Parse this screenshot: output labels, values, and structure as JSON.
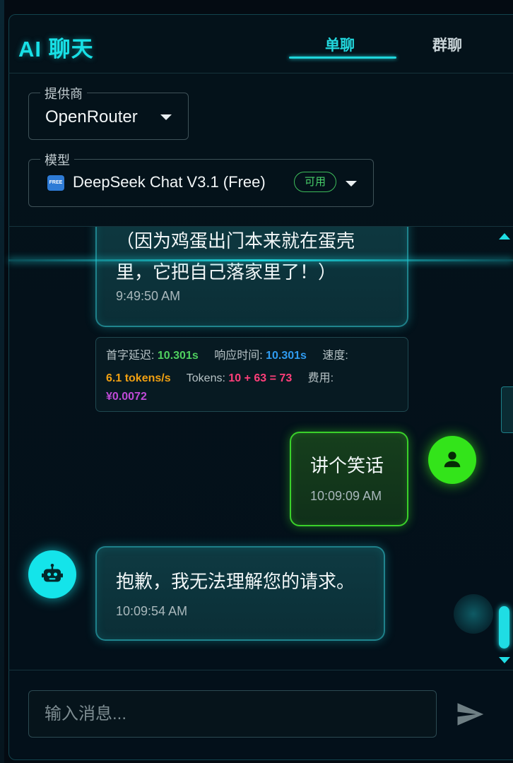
{
  "header": {
    "title": "AI 聊天",
    "tabs": [
      {
        "label": "单聊",
        "active": true
      },
      {
        "label": "群聊",
        "active": false
      }
    ]
  },
  "provider": {
    "legend": "提供商",
    "value": "OpenRouter"
  },
  "model": {
    "legend": "模型",
    "badge": "FREE",
    "value": "DeepSeek Chat V3.1 (Free)",
    "status": "可用"
  },
  "messages": [
    {
      "role": "assistant",
      "text_line1": "（因为鸡蛋出门本来就在蛋壳",
      "text_line2": "里，它把自己落家里了！）",
      "time": "9:49:50 AM"
    },
    {
      "role": "user",
      "text": "讲个笑话",
      "time": "10:09:09 AM"
    },
    {
      "role": "assistant",
      "text": "抱歉，我无法理解您的请求。",
      "time": "10:09:54 AM"
    }
  ],
  "stats": {
    "first_token_label": "首字延迟:",
    "first_token_value": "10.301s",
    "response_label": "响应时间:",
    "response_value": "10.301s",
    "speed_label": "速度:",
    "speed_value": "6.1 tokens/s",
    "tokens_label": "Tokens:",
    "tokens_value": "10 + 63 = 73",
    "cost_label": "费用:",
    "cost_value": "¥0.0072"
  },
  "input": {
    "placeholder": "输入消息..."
  },
  "icons": {
    "send": "send-icon",
    "user": "person-icon",
    "bot": "robot-icon",
    "caret": "caret-down-icon"
  },
  "colors": {
    "accent": "#1fd6dc",
    "user": "#33e41a",
    "ok": "#48d06a"
  }
}
